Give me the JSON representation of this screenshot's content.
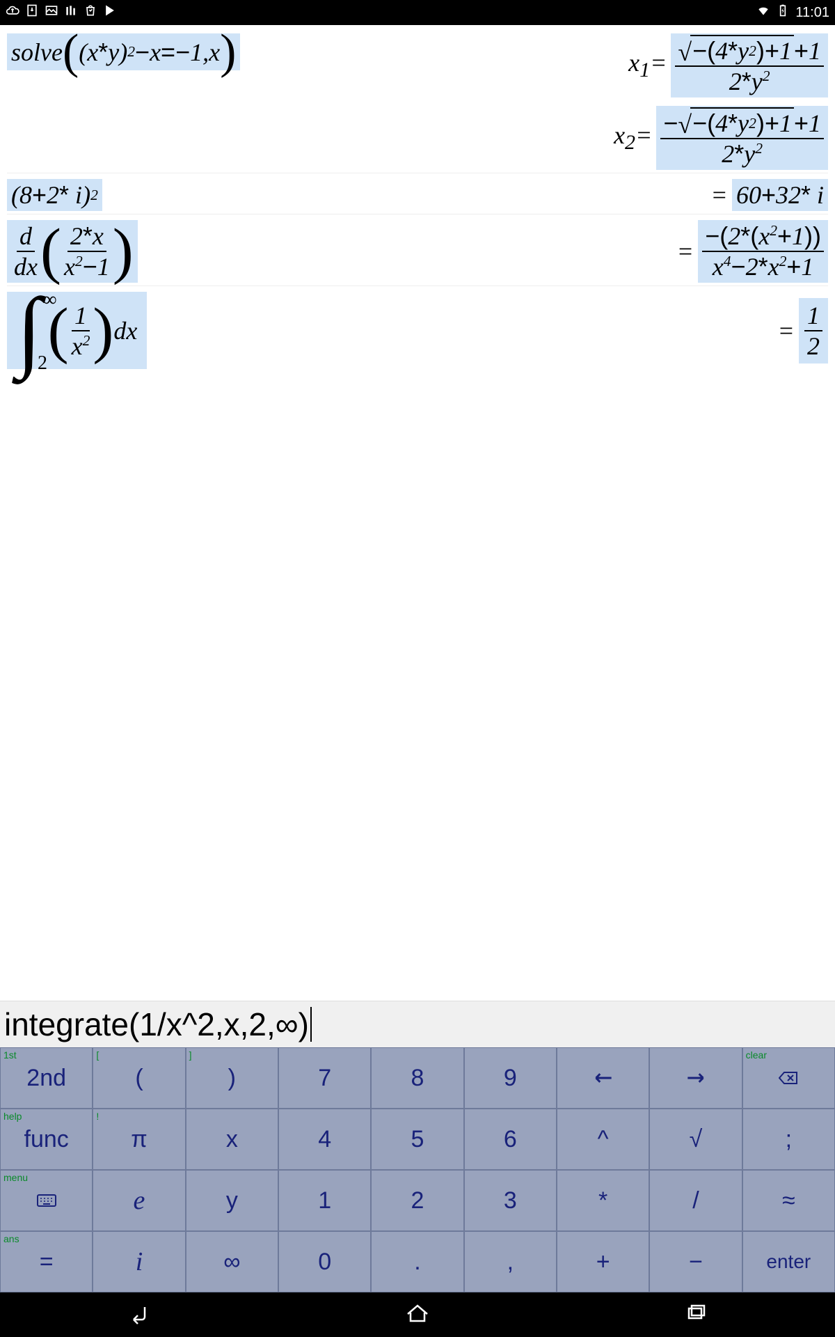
{
  "status": {
    "time": "11:01"
  },
  "history": [
    {
      "input_render": "solve((x*y)^2 - x = -1, x)",
      "outputs": [
        {
          "label": "x_1 =",
          "numer": "√(-(4*y^2)+1) + 1",
          "denom": "2*y^2"
        },
        {
          "label": "x_2 =",
          "numer": "-√(-(4*y^2)+1) + 1",
          "denom": "2*y^2"
        }
      ]
    },
    {
      "input_render": "(8+2*i)^2",
      "output_plain": "60+32*i"
    },
    {
      "input_render": "d/dx (2*x / (x^2 - 1))",
      "output_frac": {
        "numer": "-(2*(x^2+1))",
        "denom": "x^4 - 2*x^2 + 1"
      }
    },
    {
      "input_render": "∫[2,∞] (1/x^2) dx",
      "output_frac": {
        "numer": "1",
        "denom": "2"
      }
    }
  ],
  "input_line": "integrate(1/x^2,x,2,∞)",
  "keyboard": {
    "rows": [
      [
        {
          "main": "2nd",
          "sec": "1st"
        },
        {
          "main": "(",
          "sec": "["
        },
        {
          "main": ")",
          "sec": "]"
        },
        {
          "main": "7"
        },
        {
          "main": "8"
        },
        {
          "main": "9"
        },
        {
          "main": "←"
        },
        {
          "main": "→"
        },
        {
          "main": "⌫",
          "sec": "clear"
        }
      ],
      [
        {
          "main": "func",
          "sec": "help"
        },
        {
          "main": "π",
          "sec": "!"
        },
        {
          "main": "x"
        },
        {
          "main": "4"
        },
        {
          "main": "5"
        },
        {
          "main": "6"
        },
        {
          "main": "^"
        },
        {
          "main": "√"
        },
        {
          "main": ";"
        }
      ],
      [
        {
          "main": "⌨",
          "sec": "menu"
        },
        {
          "main": "e",
          "italic": true
        },
        {
          "main": "y"
        },
        {
          "main": "1"
        },
        {
          "main": "2"
        },
        {
          "main": "3"
        },
        {
          "main": "*"
        },
        {
          "main": "/"
        },
        {
          "main": "≈"
        }
      ],
      [
        {
          "main": "=",
          "sec": "ans"
        },
        {
          "main": "i",
          "italic": true
        },
        {
          "main": "∞"
        },
        {
          "main": "0"
        },
        {
          "main": "."
        },
        {
          "main": ","
        },
        {
          "main": "+"
        },
        {
          "main": "−"
        },
        {
          "main": "enter"
        }
      ]
    ]
  }
}
